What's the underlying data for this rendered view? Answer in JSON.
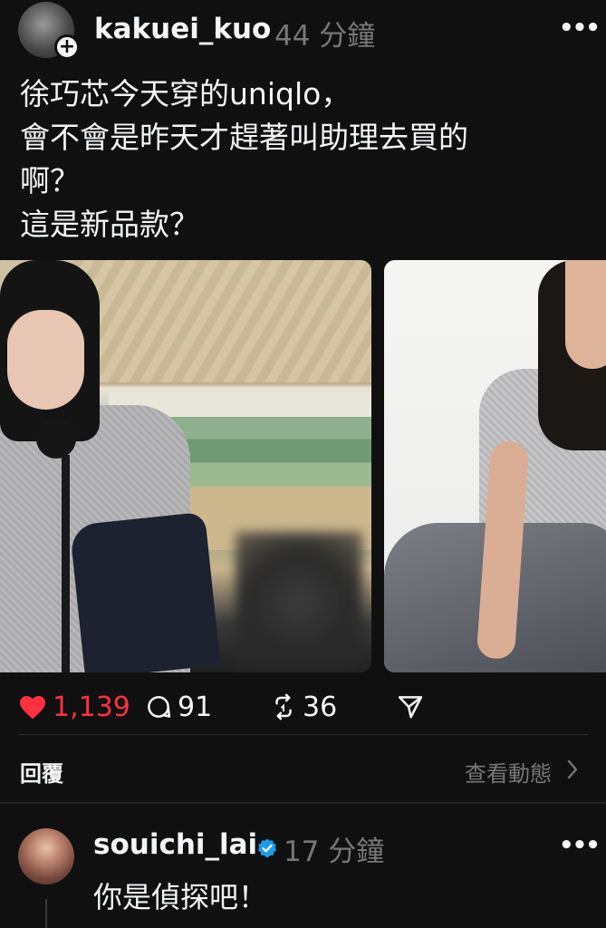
{
  "post": {
    "username": "kakuei_kuo",
    "timestamp": "44 分鐘",
    "more_icon": "more-horizontal-icon",
    "text_lines": [
      "徐巧芯今天穿的uniqlo，",
      "會不會是昨天才趕著叫助理去買的",
      "啊？",
      "這是新品款？"
    ]
  },
  "actions": {
    "likes": "1,139",
    "comments": "91",
    "reposts": "36",
    "like_color": "#ff3040"
  },
  "replies_bar": {
    "label": "回覆",
    "view_activity": "查看動態"
  },
  "reply": {
    "username": "souichi_lai",
    "timestamp": "17 分鐘",
    "text": "你是偵探吧！"
  }
}
